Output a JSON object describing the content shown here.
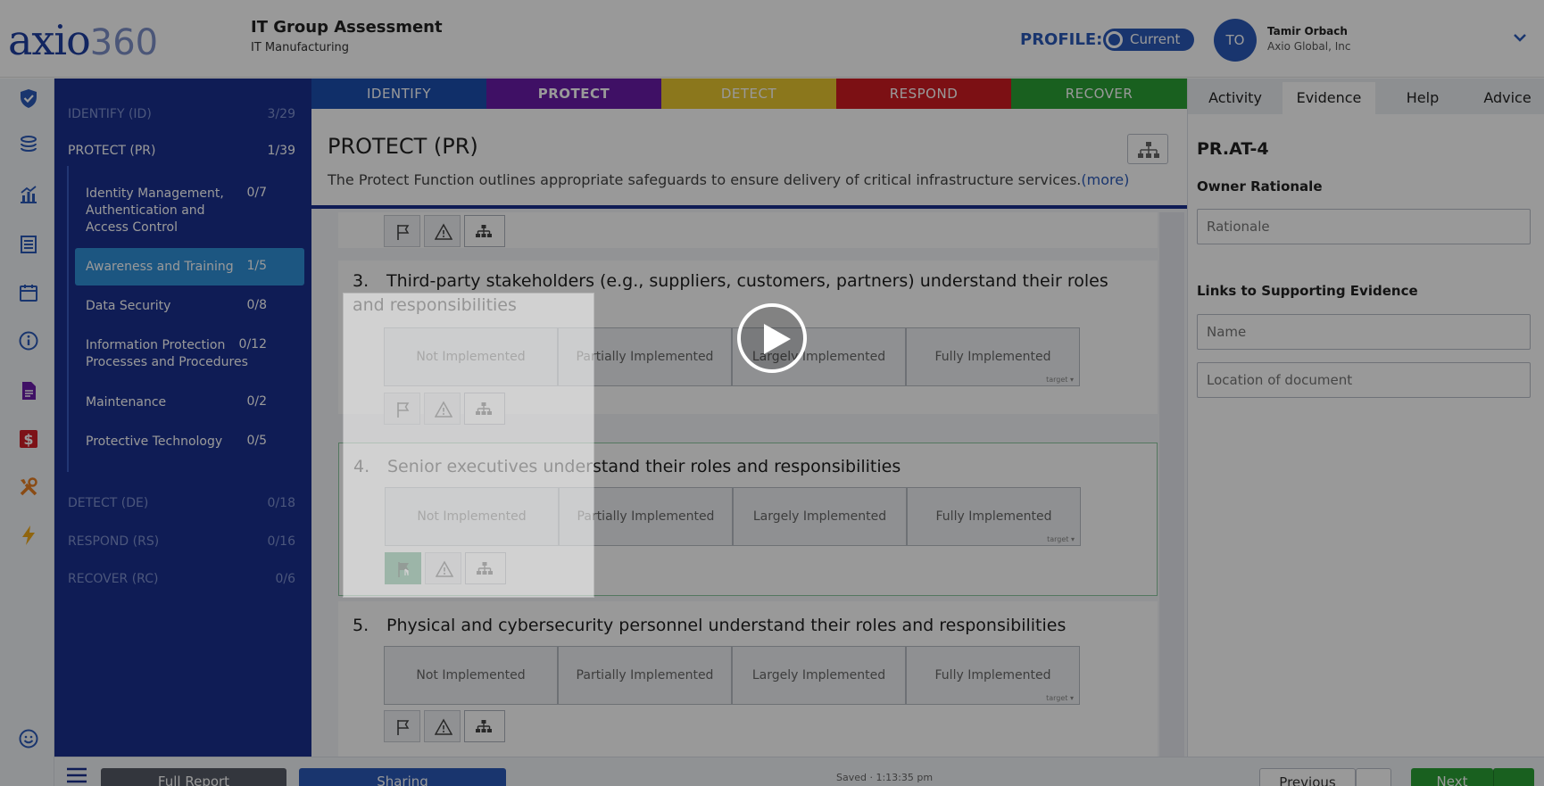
{
  "header": {
    "logo_text": "axio",
    "logo_num": "360",
    "assessment_title": "IT Group Assessment",
    "assessment_sub": "IT  Manufacturing",
    "profile_label": "PROFILE:",
    "profile_value": "Current",
    "avatar_initials": "TO",
    "user_name": "Tamir Orbach",
    "user_org": "Axio Global, Inc"
  },
  "rail_icons": [
    "shield-check-icon",
    "layers-icon",
    "chart-icon",
    "list-icon",
    "calendar-icon",
    "info-icon",
    "document-icon",
    "dollar-icon",
    "tools-icon",
    "lightning-icon",
    "smiley-icon"
  ],
  "sidebar": {
    "functions_top": [
      {
        "label": "IDENTIFY (ID)",
        "count": "3/29"
      },
      {
        "label": "PROTECT (PR)",
        "count": "1/39"
      }
    ],
    "categories": [
      {
        "label": "Identity Management, Authentication and Access Control",
        "count": "0/7"
      },
      {
        "label": "Awareness and Training",
        "count": "1/5"
      },
      {
        "label": "Data Security",
        "count": "0/8"
      },
      {
        "label": "Information Protection Processes and Procedures",
        "count": "0/12"
      },
      {
        "label": "Maintenance",
        "count": "0/2"
      },
      {
        "label": "Protective Technology",
        "count": "0/5"
      }
    ],
    "functions_bottom": [
      {
        "label": "DETECT (DE)",
        "count": "0/18"
      },
      {
        "label": "RESPOND (RS)",
        "count": "0/16"
      },
      {
        "label": "RECOVER (RC)",
        "count": "0/6"
      }
    ]
  },
  "function_tabs": [
    {
      "label": "IDENTIFY",
      "color": "#1b4fb0"
    },
    {
      "label": "PROTECT",
      "color": "#6a1ca8"
    },
    {
      "label": "DETECT",
      "color": "#e8c630"
    },
    {
      "label": "RESPOND",
      "color": "#cf1c22"
    },
    {
      "label": "RECOVER",
      "color": "#2aa035"
    }
  ],
  "main": {
    "title": "PROTECT (PR)",
    "description": "The Protect Function outlines appropriate safeguards to ensure delivery of critical infrastructure services.",
    "more_link": "(more)",
    "scale_labels": [
      "Not Implemented",
      "Partially Implemented",
      "Largely Implemented",
      "Fully Implemented"
    ],
    "target_label": "target ▾",
    "questions": [
      {
        "number": "3.",
        "text": "Third-party stakeholders (e.g., suppliers, customers, partners) understand their roles and responsibilities"
      },
      {
        "number": "4.",
        "text": "Senior executives understand their roles and responsibilities"
      },
      {
        "number": "5.",
        "text": "Physical and cybersecurity personnel understand their roles and responsibilities"
      }
    ]
  },
  "right_panel": {
    "tabs": [
      "Activity",
      "Evidence",
      "Help",
      "Advice"
    ],
    "active_tab": "Evidence",
    "code": "PR.AT-4",
    "owner_rationale_label": "Owner Rationale",
    "rationale_placeholder": "Rationale",
    "links_label": "Links to Supporting Evidence",
    "name_placeholder": "Name",
    "location_placeholder": "Location of document"
  },
  "footer": {
    "full_report": "Full Report",
    "sharing": "Sharing",
    "saved": "Saved · 1:13:35 pm",
    "previous": "Previous",
    "next": "Next"
  },
  "colors": {
    "brand_blue": "#1a2f8e",
    "accent_blue": "#2b59b8",
    "active_item": "#2f8fd8",
    "flag_green": "#3f9a6a"
  }
}
